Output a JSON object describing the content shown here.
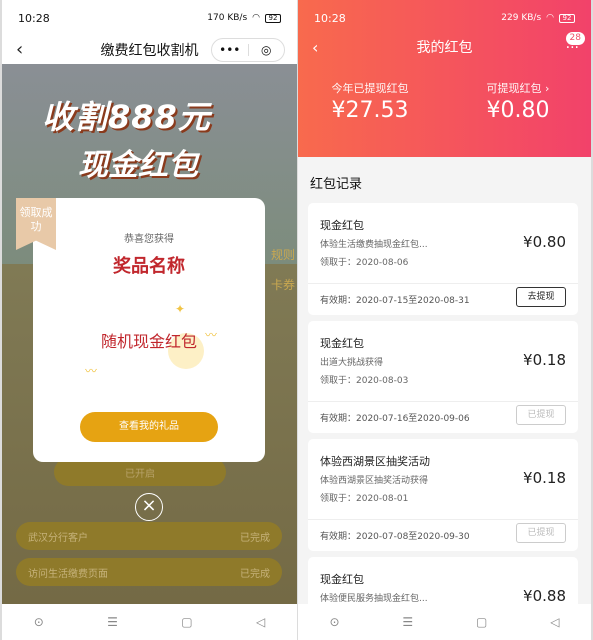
{
  "left": {
    "status": {
      "time": "10:28",
      "net": "170 KB/s",
      "battery": "92"
    },
    "title": "缴费红包收割机",
    "capsule": {
      "more": "•••",
      "close": "◎"
    },
    "banner": {
      "line1": "收割888元",
      "line2": "现金红包"
    },
    "side_labels": [
      "规则",
      "卡券"
    ],
    "modal": {
      "ribbon": "领取成功",
      "congrats": "恭喜您获得",
      "prize_name": "奖品名称",
      "prize_desc": "随机现金红包",
      "button": "查看我的礼品"
    },
    "behind_button": "已开启",
    "tasks": [
      {
        "name": "武汉分行客户",
        "status": "已完成"
      },
      {
        "name": "访问生活缴费页面",
        "status": "已完成"
      }
    ]
  },
  "right": {
    "status": {
      "time": "10:28",
      "net": "229 KB/s",
      "battery": "92"
    },
    "title": "我的红包",
    "badge": "28",
    "withdrawn": {
      "label": "今年已提现红包",
      "value": "¥27.53"
    },
    "available": {
      "label": "可提现红包 ›",
      "value": "¥0.80"
    },
    "section": "红包记录",
    "records": [
      {
        "title": "现金红包",
        "desc": "体验生活缴费抽现金红包...",
        "received": "领取于：2020-08-06",
        "amount": "¥0.80",
        "valid": "有效期：2020-07-15至2020-08-31",
        "action": "去提现",
        "disabled": false
      },
      {
        "title": "现金红包",
        "desc": "出道大挑战获得",
        "received": "领取于：2020-08-03",
        "amount": "¥0.18",
        "valid": "有效期：2020-07-16至2020-09-06",
        "action": "已提现",
        "disabled": true
      },
      {
        "title": "体验西湖景区抽奖活动",
        "desc": "体验西湖景区抽奖活动获得",
        "received": "领取于：2020-08-01",
        "amount": "¥0.18",
        "valid": "有效期：2020-07-08至2020-09-30",
        "action": "已提现",
        "disabled": true
      },
      {
        "title": "现金红包",
        "desc": "体验便民服务抽现金红包...",
        "received": "",
        "amount": "¥0.88",
        "valid": "",
        "action": "",
        "disabled": true
      }
    ]
  },
  "navbar": [
    "⊙",
    "☰",
    "▢",
    "◁"
  ]
}
